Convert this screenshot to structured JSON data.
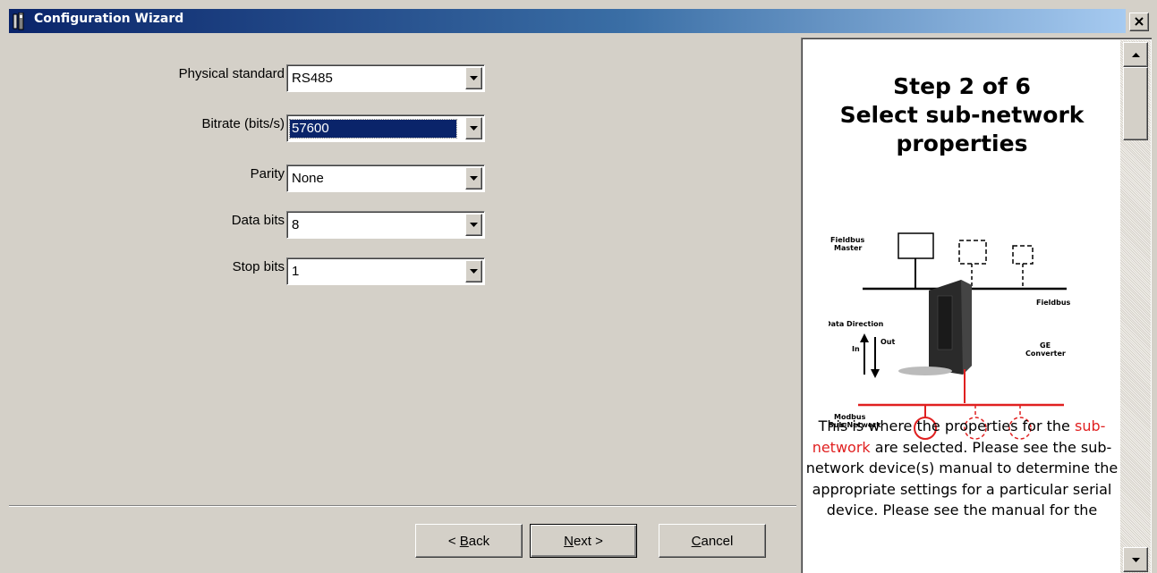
{
  "window": {
    "title": "Configuration Wizard",
    "close_glyph": "✕",
    "icon": "wizard-app-icon"
  },
  "form": {
    "fields": [
      {
        "label": "Physical standard",
        "value": "RS485"
      },
      {
        "label": "Bitrate (bits/s)",
        "value": "57600",
        "focused": true
      },
      {
        "label": "Parity",
        "value": "None"
      },
      {
        "label": "Data bits",
        "value": "8"
      },
      {
        "label": "Stop bits",
        "value": "1"
      }
    ]
  },
  "buttons": {
    "back_accel": "B",
    "back_prefix": "< ",
    "back_rest": "ack",
    "next_accel": "N",
    "next_rest": "ext >",
    "cancel_accel": "C",
    "cancel_rest": "ancel"
  },
  "help": {
    "step_line1": "Step 2 of 6",
    "step_line2": "Select sub-network",
    "step_line3": "properties",
    "diagram": {
      "fieldbus_master": [
        "Fieldbus",
        "Master"
      ],
      "fieldbus": "Fieldbus",
      "data_direction": "Data  Direction",
      "in": "In",
      "out": "Out",
      "converter": [
        "GE",
        "Converter"
      ],
      "modbus": [
        "Modbus",
        "Sub-Network"
      ]
    },
    "text_before_link": "This is where the properties for the ",
    "link": "sub-network",
    "text_after_link": " are selected. Please see the sub-network device(s) manual to determine the appropriate settings for a particular serial device. Please see the manual for the"
  },
  "colors": {
    "titlebar_start": "#0a246a",
    "titlebar_end": "#a6caf0",
    "selection": "#0a246a",
    "link": "#e02020",
    "face": "#d4d0c8"
  }
}
